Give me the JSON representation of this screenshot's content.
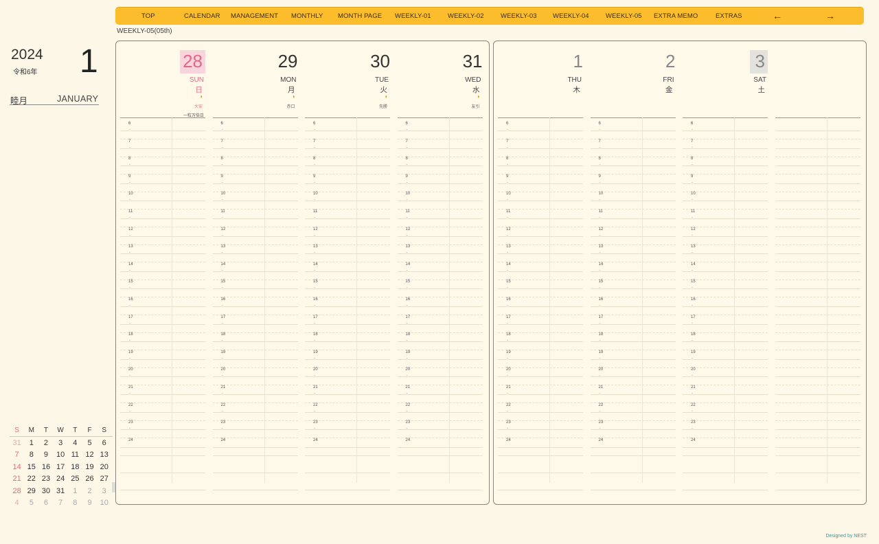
{
  "nav": {
    "items": [
      "TOP",
      "CALENDAR",
      "MANAGEMENT",
      "MONTHLY",
      "MONTH PAGE",
      "WEEKLY-01",
      "WEEKLY-02",
      "WEEKLY-03",
      "WEEKLY-04",
      "WEEKLY-05",
      "EXTRA MEMO",
      "EXTRAS"
    ],
    "prev_arrow": "←",
    "next_arrow": "→"
  },
  "subtitle": "WEEKLY-05(05th)",
  "left": {
    "year": "2024",
    "era": "令和6年",
    "month_number": "1",
    "month_jp": "睦月",
    "month_en": "JANUARY"
  },
  "mini_calendar": {
    "headers": [
      "S",
      "M",
      "T",
      "W",
      "T",
      "F",
      "S"
    ],
    "weeks": [
      [
        "31",
        "1",
        "2",
        "3",
        "4",
        "5",
        "6"
      ],
      [
        "7",
        "8",
        "9",
        "10",
        "11",
        "12",
        "13"
      ],
      [
        "14",
        "15",
        "16",
        "17",
        "18",
        "19",
        "20"
      ],
      [
        "21",
        "22",
        "23",
        "24",
        "25",
        "26",
        "27"
      ],
      [
        "28",
        "29",
        "30",
        "31",
        "1",
        "2",
        "3"
      ],
      [
        "4",
        "5",
        "6",
        "7",
        "8",
        "9",
        "10"
      ]
    ]
  },
  "days": [
    {
      "num": "28",
      "en": "SUN",
      "jp": "日",
      "rokuyo": "大安",
      "event": "一粒万倍日",
      "moon": "◑"
    },
    {
      "num": "29",
      "en": "MON",
      "jp": "月",
      "rokuyo": "赤口",
      "event": "",
      "moon": "◑"
    },
    {
      "num": "30",
      "en": "TUE",
      "jp": "火",
      "rokuyo": "先勝",
      "event": "",
      "moon": "◑"
    },
    {
      "num": "31",
      "en": "WED",
      "jp": "水",
      "rokuyo": "友引",
      "event": "",
      "moon": "◑"
    },
    {
      "num": "1",
      "en": "THU",
      "jp": "木",
      "rokuyo": "",
      "event": "",
      "moon": ""
    },
    {
      "num": "2",
      "en": "FRI",
      "jp": "金",
      "rokuyo": "",
      "event": "",
      "moon": ""
    },
    {
      "num": "3",
      "en": "SAT",
      "jp": "土",
      "rokuyo": "",
      "event": "",
      "moon": ""
    }
  ],
  "hours": [
    "6",
    "7",
    "8",
    "9",
    "10",
    "11",
    "12",
    "13",
    "14",
    "15",
    "16",
    "17",
    "18",
    "19",
    "20",
    "21",
    "22",
    "23",
    "24"
  ],
  "half_mark": "-",
  "credit": "Designed by NEST",
  "colors": {
    "nav": "#fbbd2c",
    "background": "#fdf7e8",
    "sunday": "#e06a86",
    "border": "#8a8578"
  }
}
